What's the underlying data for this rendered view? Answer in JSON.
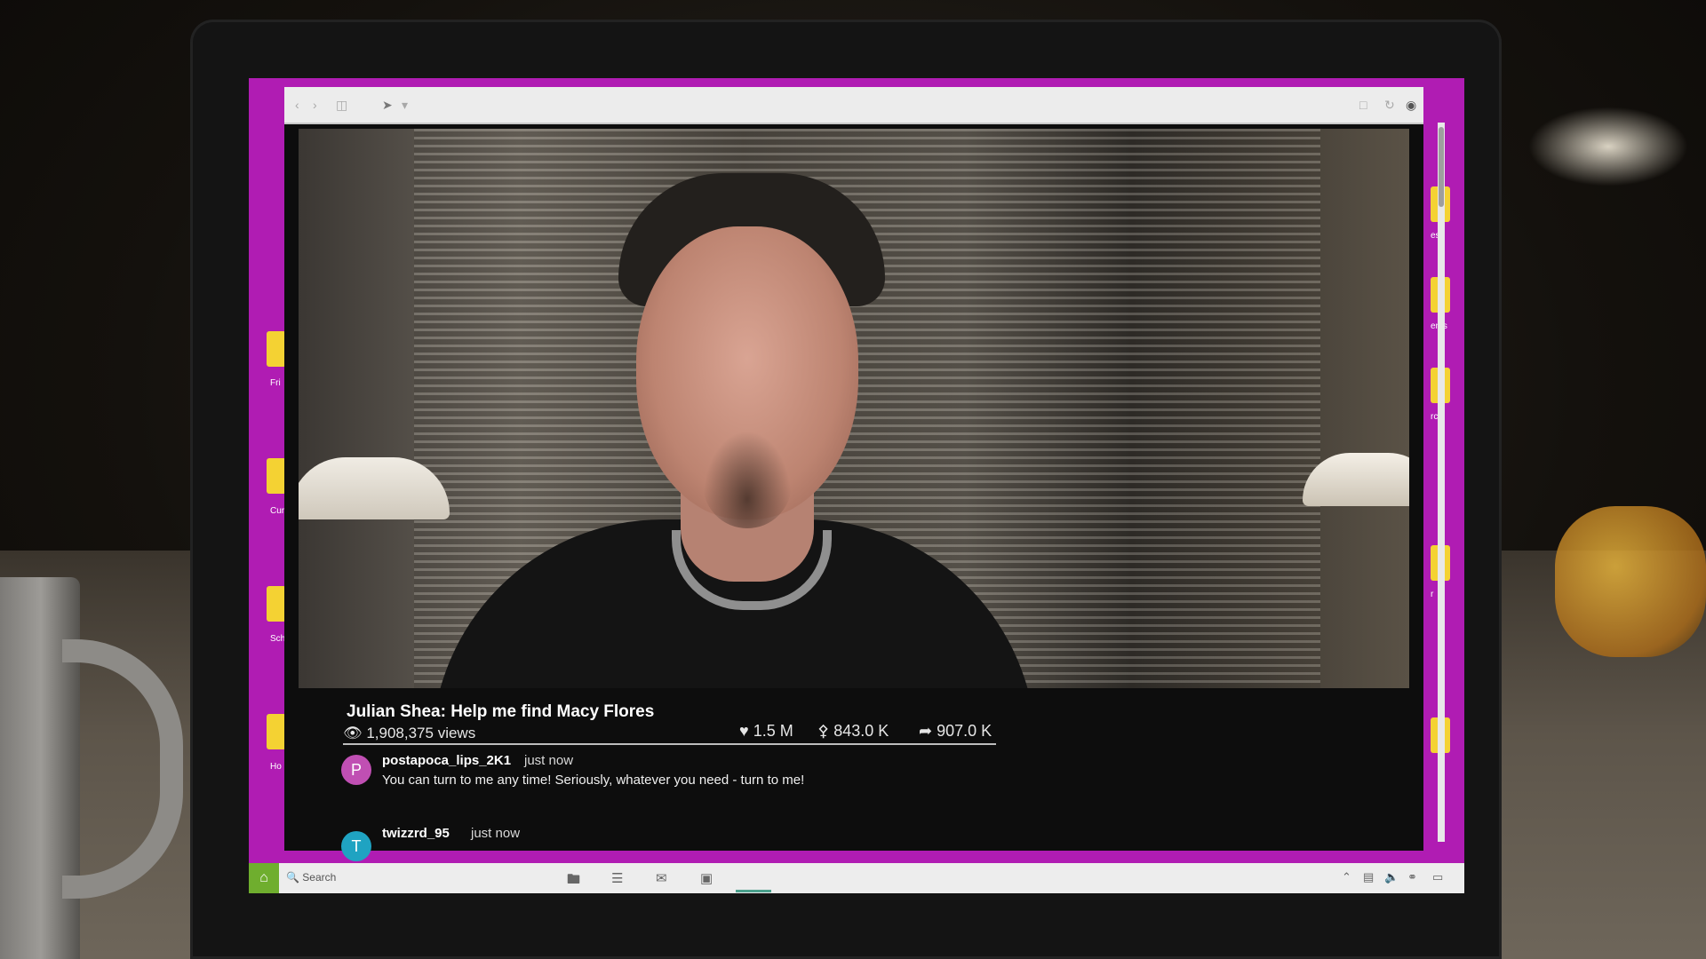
{
  "desktop": {
    "icons": [
      {
        "label": "Fri",
        "side": "left"
      },
      {
        "label": "Cur",
        "side": "left"
      },
      {
        "label": "Sch",
        "side": "left"
      },
      {
        "label": "Ho",
        "side": "left"
      },
      {
        "label": "es",
        "side": "right"
      },
      {
        "label": "ents",
        "side": "right"
      },
      {
        "label": "rch",
        "side": "right"
      },
      {
        "label": "r",
        "side": "right"
      }
    ]
  },
  "browser": {
    "toolbar_icons": [
      "back-icon",
      "forward-icon",
      "sidebar-icon",
      "cursor-icon",
      "share-icon",
      "reload-icon",
      "download-icon"
    ]
  },
  "video": {
    "title": "Julian Shea: Help me find Macy Flores",
    "views": "1,908,375",
    "views_label": "views",
    "likes": "1.5 M",
    "reposts": "843.0 K",
    "shares": "907.0 K"
  },
  "comments": [
    {
      "avatar_letter": "P",
      "avatar_color": "#c04fb3",
      "username": "postapoca_lips_2K1",
      "time": "just now",
      "text": "You can turn to me any time! Seriously, whatever you need - turn to me!"
    },
    {
      "avatar_letter": "T",
      "avatar_color": "#1fa3c2",
      "username": "twizzrd_95",
      "time": "just now",
      "text": ""
    }
  ],
  "taskbar": {
    "search_placeholder": "Search",
    "apps": [
      "folder-icon",
      "list-icon",
      "mail-icon",
      "window-icon"
    ],
    "tray": [
      "chevron-up-icon",
      "network-icon",
      "volume-icon",
      "wifi-icon",
      "battery-icon"
    ]
  },
  "colors": {
    "desktop_bg": "#b01cb3",
    "folder": "#f4d233",
    "home_button": "#6fae2e"
  }
}
